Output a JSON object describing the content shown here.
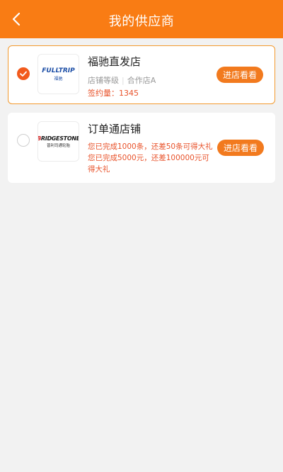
{
  "header": {
    "title": "我的供应商"
  },
  "suppliers": [
    {
      "name": "福驰直发店",
      "selected": true,
      "logo_text": "FULLTRIP",
      "logo_sub": "福驰",
      "level_label": "店铺等级",
      "level_value": "合作店A",
      "sign_text": "签约量：1345",
      "button_label": "进店看看"
    },
    {
      "name": "订单通店铺",
      "selected": false,
      "logo_text_prefix": "B",
      "logo_text": "RIDGESTONE",
      "logo_sub": "普利司通轮胎",
      "promo_lines": [
        "您已完成1000条，还差50条可得大礼",
        "您已完成5000元，还差100000元可得大礼"
      ],
      "button_label": "进店看看"
    }
  ],
  "colors": {
    "header_bg": "#f97c14",
    "accent": "#f27a1e",
    "promo_text": "#e8522a"
  }
}
